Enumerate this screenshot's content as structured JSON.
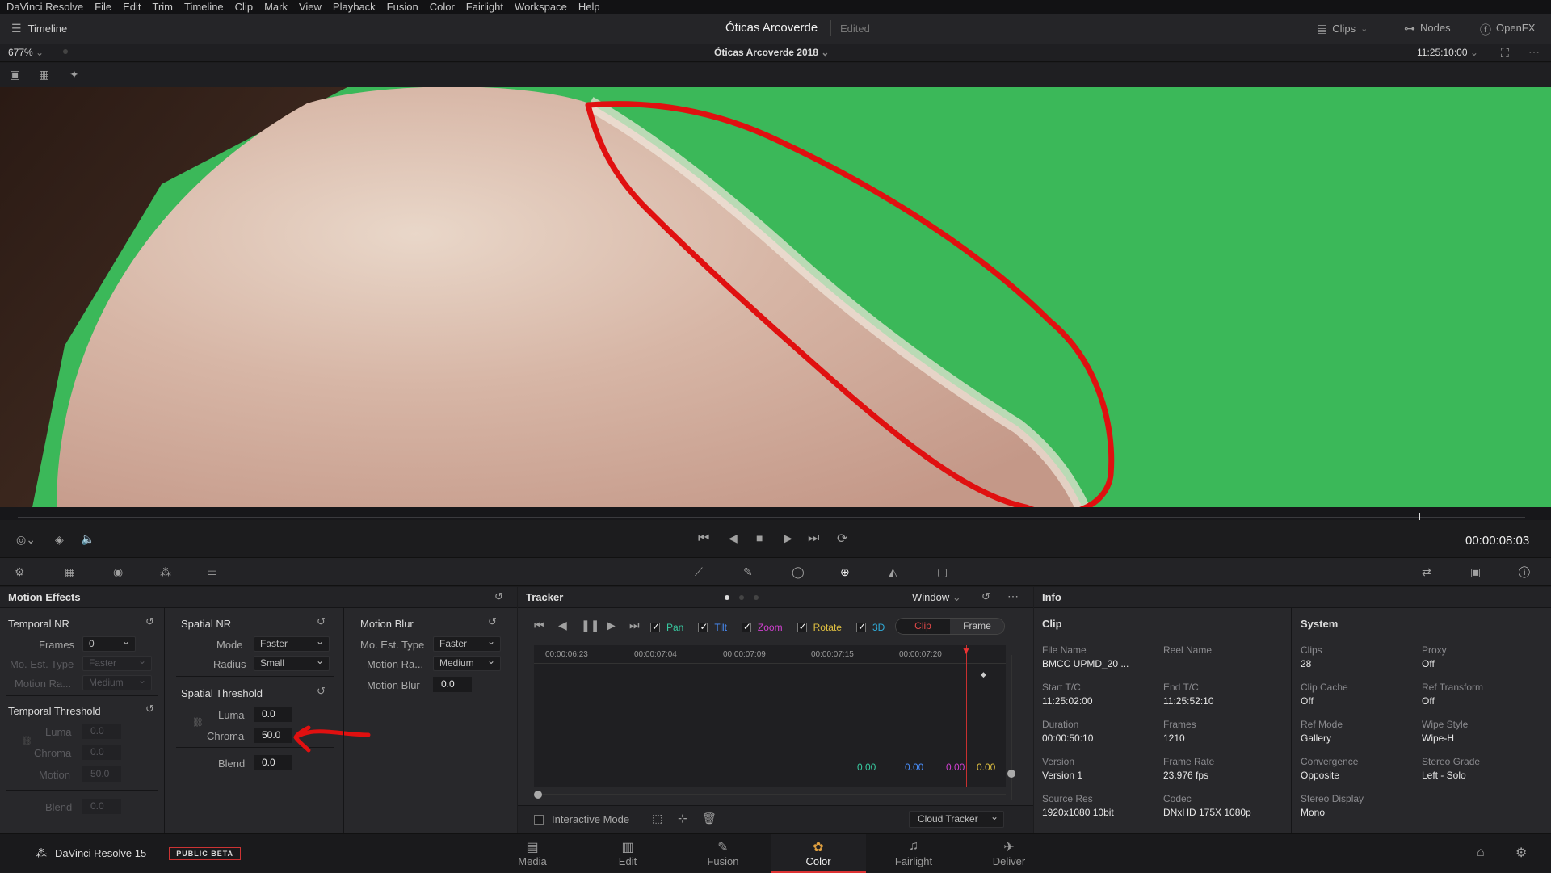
{
  "menu": [
    "DaVinci Resolve",
    "File",
    "Edit",
    "Trim",
    "Timeline",
    "Clip",
    "Mark",
    "View",
    "Playback",
    "Fusion",
    "Color",
    "Fairlight",
    "Workspace",
    "Help"
  ],
  "header": {
    "timeline_label": "Timeline",
    "project": "Óticas Arcoverde",
    "edited": "Edited",
    "clips": "Clips",
    "nodes": "Nodes",
    "openfx": "OpenFX"
  },
  "viewer": {
    "zoom": "677%",
    "timeline_name": "Óticas Arcoverde 2018",
    "timecode": "11:25:10:00",
    "playhead_tc": "00:00:08:03"
  },
  "motion_effects": {
    "title": "Motion Effects",
    "temporal_nr": {
      "title": "Temporal NR",
      "frames_label": "Frames",
      "frames": "0",
      "mo_est_label": "Mo. Est. Type",
      "mo_est": "Faster",
      "motion_range_label": "Motion Ra...",
      "motion_range": "Medium"
    },
    "temporal_threshold": {
      "title": "Temporal Threshold",
      "luma_label": "Luma",
      "luma": "0.0",
      "chroma_label": "Chroma",
      "chroma": "0.0",
      "motion_label": "Motion",
      "motion": "50.0",
      "blend_label": "Blend",
      "blend": "0.0"
    },
    "spatial_nr": {
      "title": "Spatial NR",
      "mode_label": "Mode",
      "mode": "Faster",
      "radius_label": "Radius",
      "radius": "Small"
    },
    "spatial_threshold": {
      "title": "Spatial Threshold",
      "luma_label": "Luma",
      "luma": "0.0",
      "chroma_label": "Chroma",
      "chroma": "50.0",
      "blend_label": "Blend",
      "blend": "0.0"
    },
    "motion_blur": {
      "title": "Motion Blur",
      "mo_est_label": "Mo. Est. Type",
      "mo_est": "Faster",
      "motion_range_label": "Motion Ra...",
      "motion_range": "Medium",
      "blur_label": "Motion Blur",
      "blur": "0.0"
    }
  },
  "tracker": {
    "title": "Tracker",
    "mode": "Window",
    "checks": [
      {
        "label": "Pan",
        "color": "#38c9a0"
      },
      {
        "label": "Tilt",
        "color": "#4a90ff"
      },
      {
        "label": "Zoom",
        "color": "#d040d0"
      },
      {
        "label": "Rotate",
        "color": "#e0c040"
      },
      {
        "label": "3D",
        "color": "#2fa9d6"
      }
    ],
    "seg_clip": "Clip",
    "seg_frame": "Frame",
    "ticks": [
      "00:00:06:23",
      "00:00:07:04",
      "00:00:07:09",
      "00:00:07:15",
      "00:00:07:20"
    ],
    "values": [
      {
        "v": "0.00",
        "color": "#38c9a0"
      },
      {
        "v": "0.00",
        "color": "#4a90ff"
      },
      {
        "v": "0.00",
        "color": "#d040d0"
      },
      {
        "v": "0.00",
        "color": "#e0c040"
      }
    ],
    "interactive_mode": "Interactive Mode",
    "cloud_tracker": "Cloud Tracker"
  },
  "info": {
    "title": "Info",
    "clip_title": "Clip",
    "system_title": "System",
    "clip": [
      {
        "k": "File Name",
        "v": "BMCC UPMD_20 ..."
      },
      {
        "k": "Reel Name",
        "v": ""
      },
      {
        "k": "Start T/C",
        "v": "11:25:02:00"
      },
      {
        "k": "End T/C",
        "v": "11:25:52:10"
      },
      {
        "k": "Duration",
        "v": "00:00:50:10"
      },
      {
        "k": "Frames",
        "v": "1210"
      },
      {
        "k": "Version",
        "v": "Version 1"
      },
      {
        "k": "Frame Rate",
        "v": "23.976 fps"
      },
      {
        "k": "Source Res",
        "v": "1920x1080 10bit"
      },
      {
        "k": "Codec",
        "v": "DNxHD 175X 1080p"
      }
    ],
    "system": [
      {
        "k": "Clips",
        "v": "28"
      },
      {
        "k": "Proxy",
        "v": "Off"
      },
      {
        "k": "Clip Cache",
        "v": "Off"
      },
      {
        "k": "Ref Transform",
        "v": "Off"
      },
      {
        "k": "Ref Mode",
        "v": "Gallery"
      },
      {
        "k": "Wipe Style",
        "v": "Wipe-H"
      },
      {
        "k": "Convergence",
        "v": "Opposite"
      },
      {
        "k": "Stereo Grade",
        "v": "Left - Solo"
      },
      {
        "k": "Stereo Display",
        "v": "Mono"
      },
      {
        "k": "",
        "v": ""
      }
    ]
  },
  "footer": {
    "app": "DaVinci Resolve 15",
    "beta": "PUBLIC BETA",
    "pages": [
      "Media",
      "Edit",
      "Fusion",
      "Color",
      "Fairlight",
      "Deliver"
    ],
    "active_page": "Color"
  },
  "colors": {
    "accent": "#d33a3a",
    "green_screen": "#3bb859",
    "annotation": "#e01010"
  }
}
